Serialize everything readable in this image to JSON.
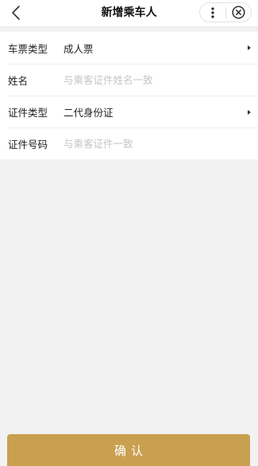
{
  "header": {
    "title": "新增乘车人"
  },
  "form": {
    "ticket_type": {
      "label": "车票类型",
      "value": "成人票"
    },
    "name": {
      "label": "姓名",
      "placeholder": "与乘客证件姓名一致",
      "value": ""
    },
    "id_type": {
      "label": "证件类型",
      "value": "二代身份证"
    },
    "id_number": {
      "label": "证件号码",
      "placeholder": "与乘客证件一致",
      "value": ""
    }
  },
  "footer": {
    "confirm_label": "确认"
  },
  "colors": {
    "accent": "#c9a050",
    "background": "#f2f2f2",
    "placeholder": "#c4c4c4"
  },
  "icons": [
    "back-chevron-icon",
    "more-dots-icon",
    "close-circle-icon",
    "arrow-right-icon"
  ]
}
